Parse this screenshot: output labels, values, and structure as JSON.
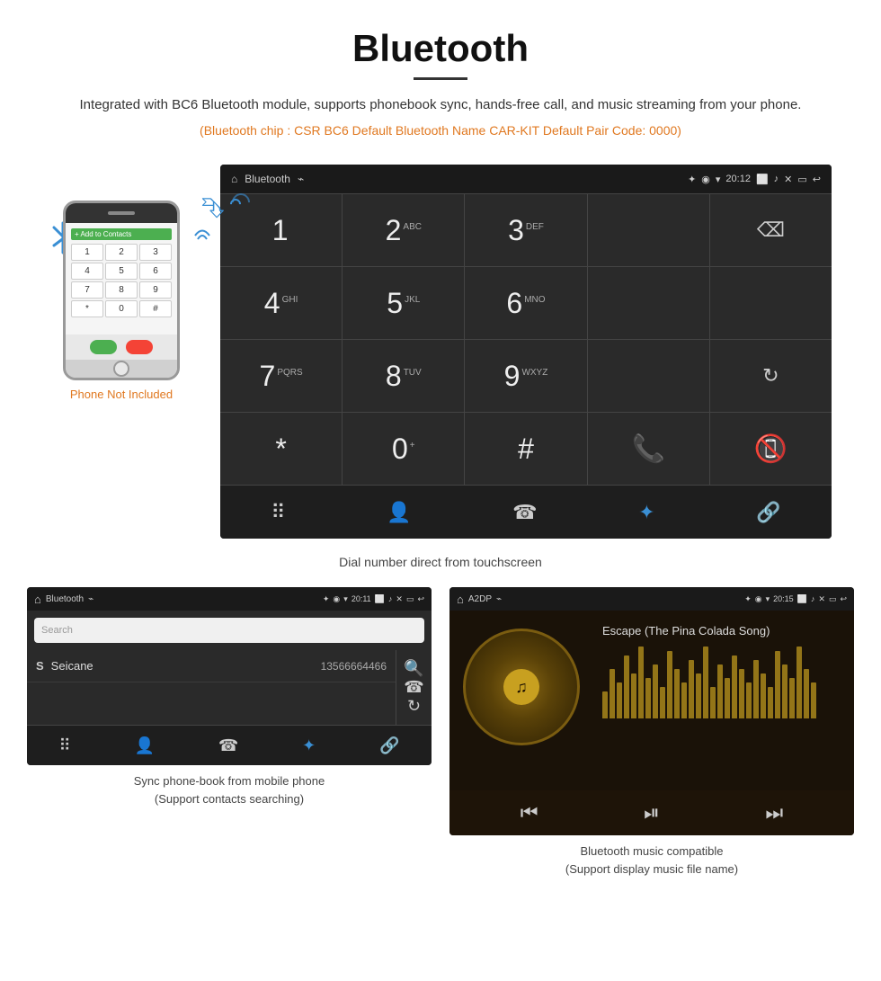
{
  "page": {
    "title": "Bluetooth",
    "subtitle": "Integrated with BC6 Bluetooth module, supports phonebook sync, hands-free call, and music streaming from your phone.",
    "specs": "(Bluetooth chip : CSR BC6    Default Bluetooth Name CAR-KIT    Default Pair Code: 0000)",
    "dial_caption": "Dial number direct from touchscreen",
    "phonebook_caption": "Sync phone-book from mobile phone\n(Support contacts searching)",
    "music_caption": "Bluetooth music compatible\n(Support display music file name)",
    "phone_not_included": "Phone Not Included"
  },
  "dial_screen": {
    "title": "Bluetooth",
    "time": "20:12",
    "keys": [
      {
        "num": "1",
        "sub": ""
      },
      {
        "num": "2",
        "sub": "ABC"
      },
      {
        "num": "3",
        "sub": "DEF"
      },
      {
        "num": "4",
        "sub": "GHI"
      },
      {
        "num": "5",
        "sub": "JKL"
      },
      {
        "num": "6",
        "sub": "MNO"
      },
      {
        "num": "7",
        "sub": "PQRS"
      },
      {
        "num": "8",
        "sub": "TUV"
      },
      {
        "num": "9",
        "sub": "WXYZ"
      },
      {
        "num": "*",
        "sub": ""
      },
      {
        "num": "0",
        "sub": "+"
      },
      {
        "num": "#",
        "sub": ""
      }
    ]
  },
  "phonebook_screen": {
    "title": "Bluetooth",
    "time": "20:11",
    "search_placeholder": "Search",
    "contact": {
      "letter": "S",
      "name": "Seicane",
      "number": "13566664466"
    }
  },
  "music_screen": {
    "title": "A2DP",
    "time": "20:15",
    "song_title": "Escape (The Pina Colada Song)"
  },
  "viz_bars": [
    30,
    55,
    40,
    70,
    50,
    80,
    45,
    60,
    35,
    75,
    55,
    40,
    65,
    50,
    80,
    35,
    60,
    45,
    70,
    55,
    40,
    65,
    50,
    35,
    75,
    60,
    45,
    80,
    55,
    40
  ]
}
